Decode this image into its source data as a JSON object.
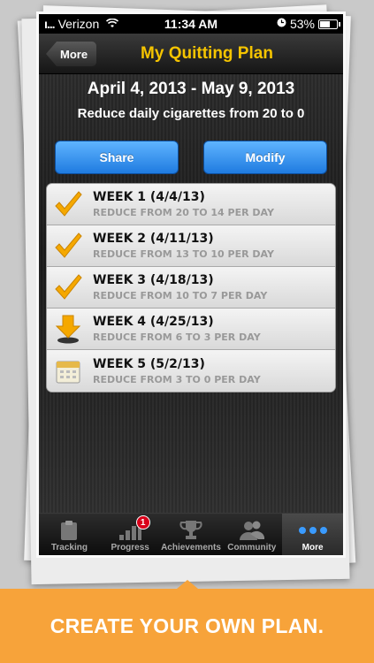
{
  "status_bar": {
    "carrier": "Verizon",
    "signal": "ı...",
    "time": "11:34 AM",
    "battery": "53%"
  },
  "nav": {
    "back_label": "More",
    "title": "My Quitting Plan"
  },
  "plan": {
    "date_range": "April 4, 2013 - May 9, 2013",
    "summary": "Reduce daily cigarettes from 20 to 0"
  },
  "actions": {
    "share_label": "Share",
    "modify_label": "Modify"
  },
  "weeks": [
    {
      "title": "WEEK 1 (4/4/13)",
      "subtitle": "REDUCE FROM 20 TO 14 PER DAY",
      "icon": "checkmark-icon"
    },
    {
      "title": "WEEK 2 (4/11/13)",
      "subtitle": "REDUCE FROM 13 TO 10 PER DAY",
      "icon": "checkmark-icon"
    },
    {
      "title": "WEEK 3 (4/18/13)",
      "subtitle": "REDUCE FROM 10 TO 7 PER DAY",
      "icon": "checkmark-icon"
    },
    {
      "title": "WEEK 4 (4/25/13)",
      "subtitle": "REDUCE FROM 6 TO 3 PER DAY",
      "icon": "current-arrow-icon"
    },
    {
      "title": "WEEK 5 (5/2/13)",
      "subtitle": "REDUCE FROM 3 TO 0 PER DAY",
      "icon": "calendar-icon"
    }
  ],
  "tabs": [
    {
      "label": "Tracking",
      "icon": "clipboard-icon"
    },
    {
      "label": "Progress",
      "icon": "bar-chart-icon",
      "badge": "1"
    },
    {
      "label": "Achievements",
      "icon": "trophy-icon"
    },
    {
      "label": "Community",
      "icon": "people-icon"
    },
    {
      "label": "More",
      "icon": "more-dots-icon",
      "active": true
    }
  ],
  "banner": {
    "text": "CREATE YOUR OWN PLAN."
  },
  "colors": {
    "title_yellow": "#f5c400",
    "button_blue": "#1f7be0",
    "banner_orange": "#f7a33a",
    "check_orange": "#f5a800",
    "badge_red": "#d9001a"
  }
}
